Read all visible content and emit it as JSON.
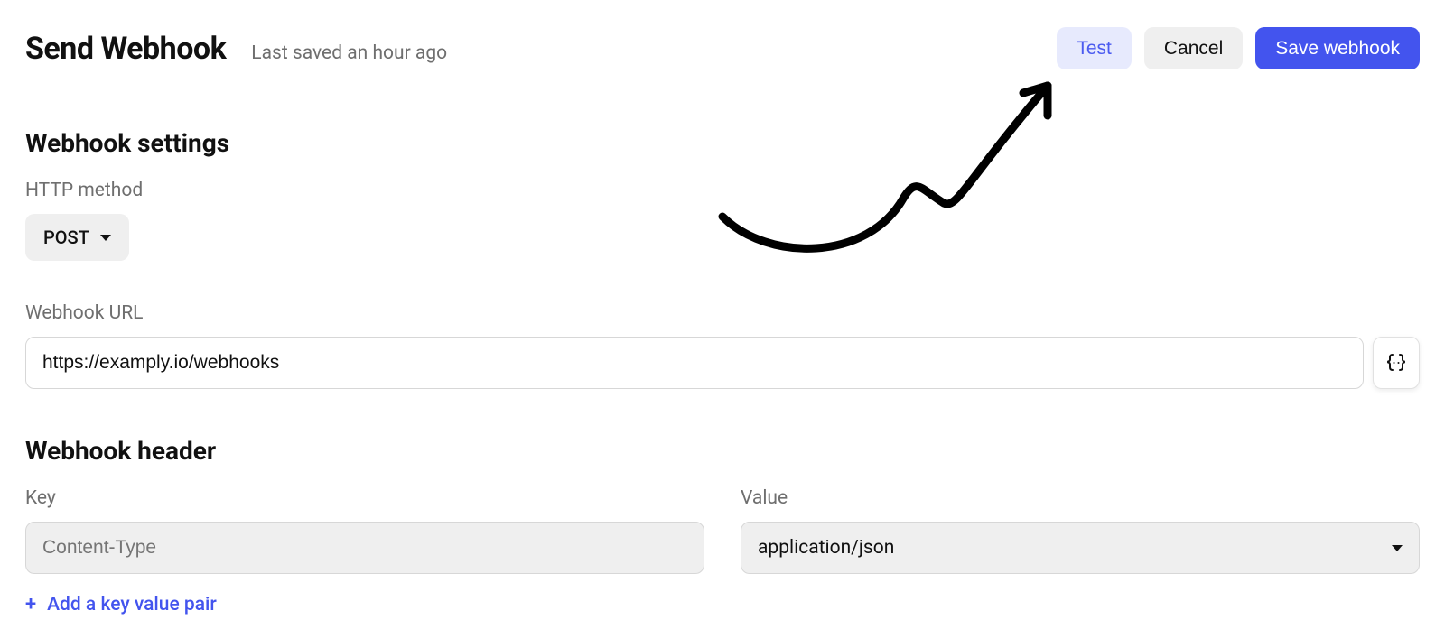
{
  "header": {
    "title": "Send Webhook",
    "last_saved": "Last saved an hour ago",
    "actions": {
      "test": "Test",
      "cancel": "Cancel",
      "save": "Save webhook"
    }
  },
  "settings": {
    "section_title": "Webhook settings",
    "http_method_label": "HTTP method",
    "http_method_value": "POST",
    "url_label": "Webhook URL",
    "url_value": "https://examply.io/webhooks"
  },
  "headers": {
    "section_title": "Webhook header",
    "key_label": "Key",
    "value_label": "Value",
    "key_placeholder": "Content-Type",
    "value_selected": "application/json",
    "add_link_label": "Add a key value pair"
  }
}
